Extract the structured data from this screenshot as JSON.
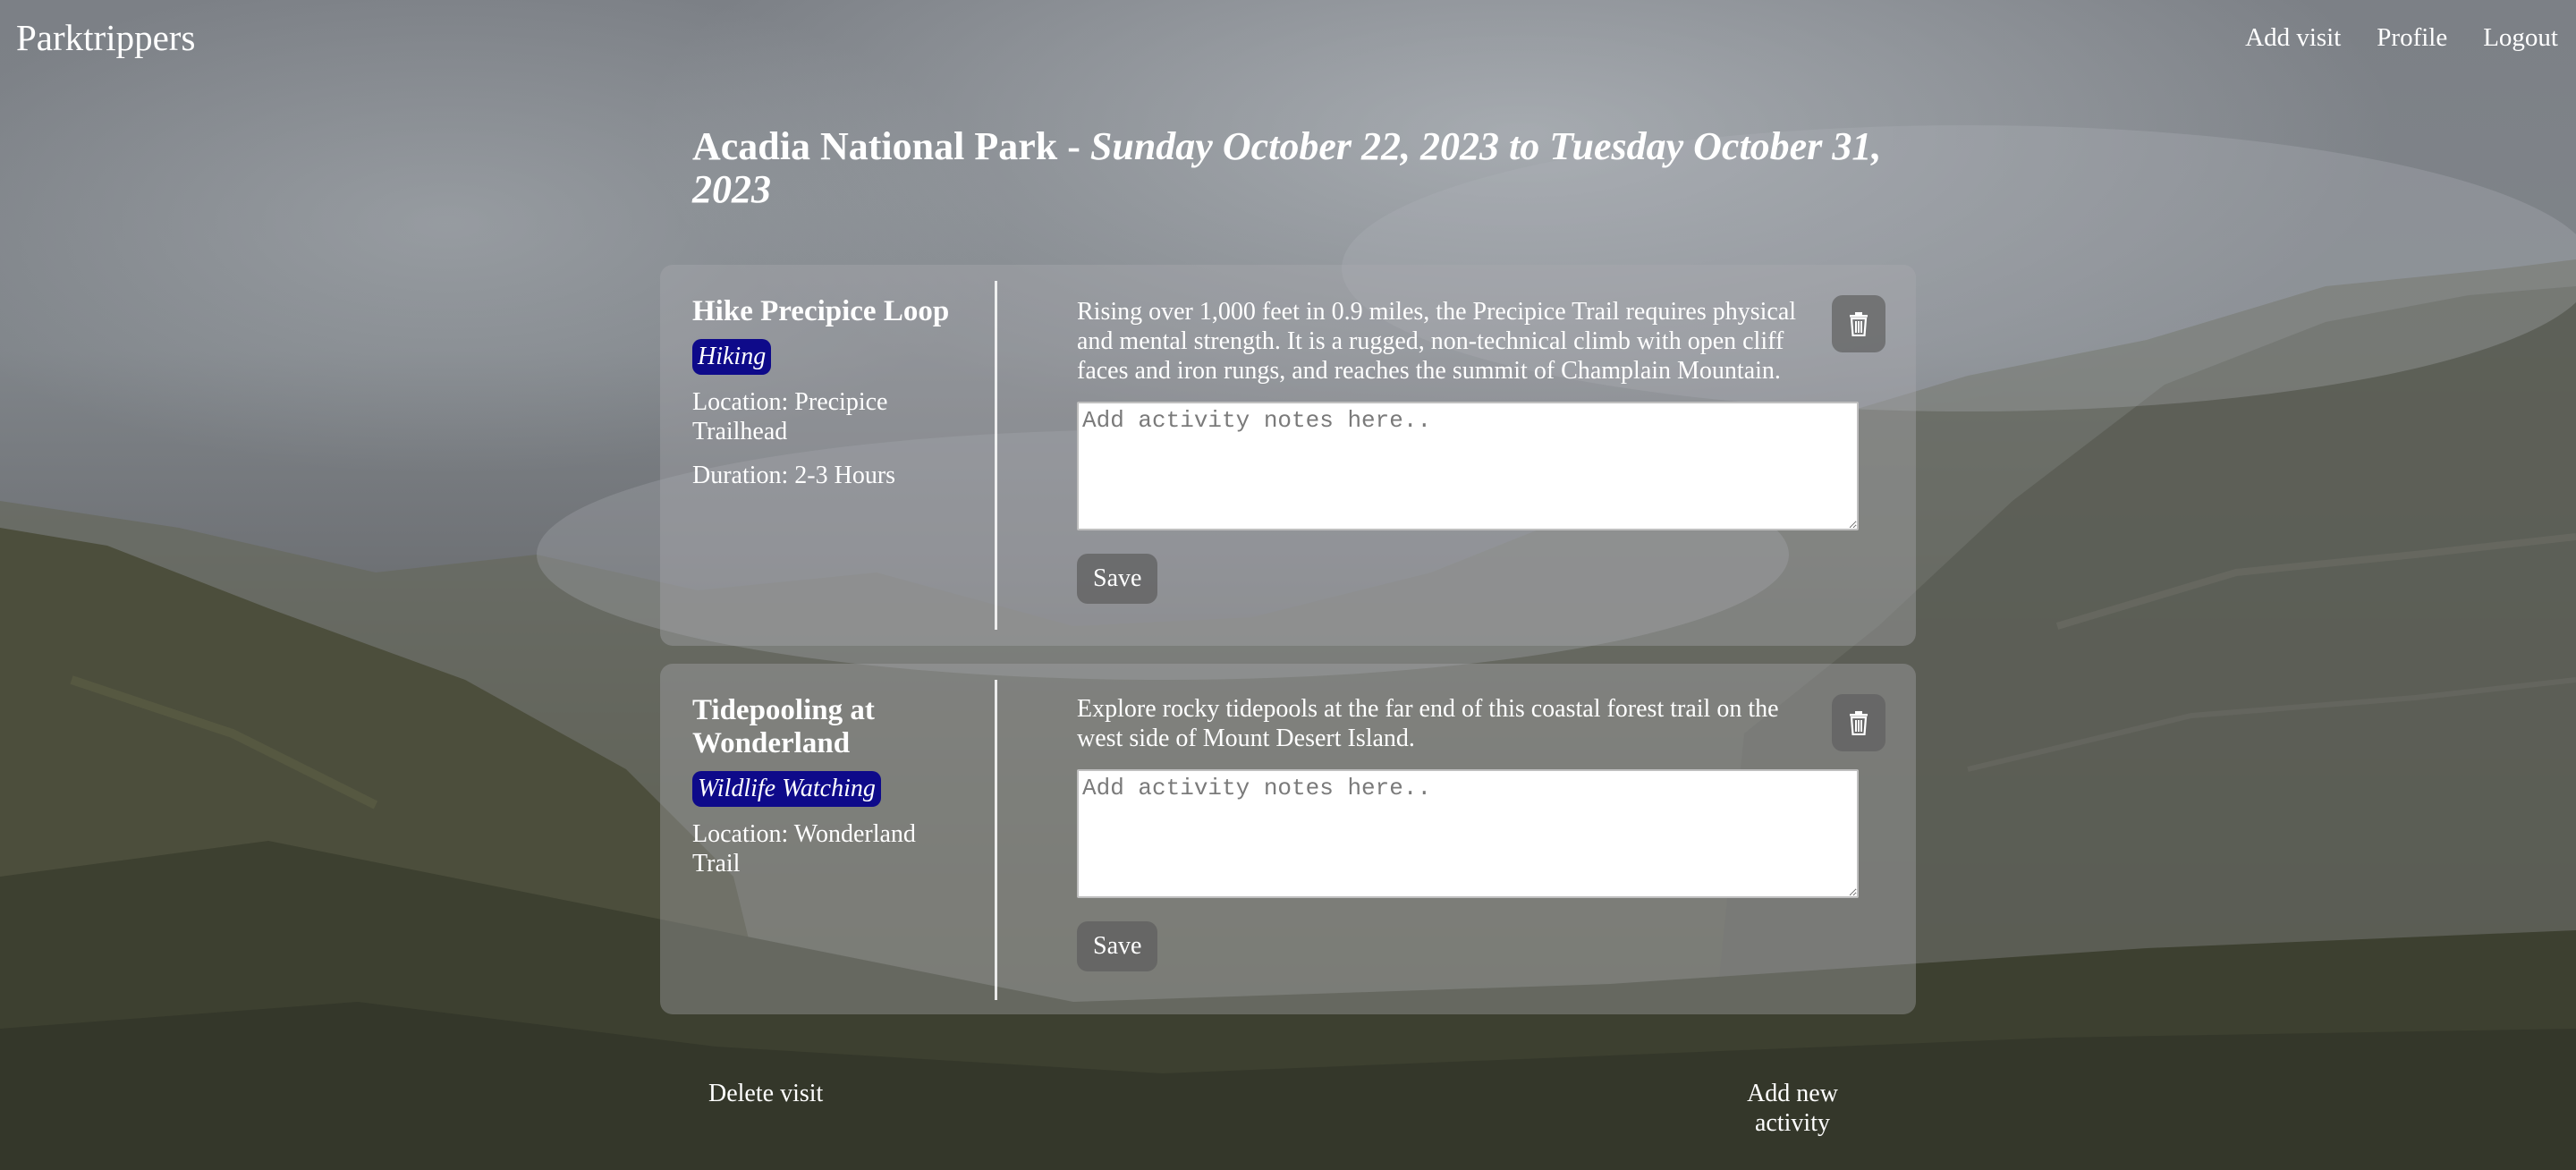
{
  "nav": {
    "brand": "Parktrippers",
    "links": [
      "Add visit",
      "Profile",
      "Logout"
    ]
  },
  "visit": {
    "park": "Acadia National Park",
    "separator": " - ",
    "dates": "Sunday October 22, 2023 to Tuesday October 31, 2023"
  },
  "activities": [
    {
      "title": "Hike Precipice Loop",
      "category": "Hiking",
      "location": "Location: Precipice Trailhead",
      "duration": "Duration: 2-3 Hours",
      "description": "Rising over 1,000 feet in 0.9 miles, the Precipice Trail requires physical and mental strength. It is a rugged, non-technical climb with open cliff faces and iron rungs, and reaches the summit of Champlain Mountain.",
      "notes_value": "",
      "notes_placeholder": "Add activity notes here..",
      "save_label": "Save",
      "delete_icon": "trash-icon"
    },
    {
      "title": "Tidepooling at Wonderland",
      "category": "Wildlife Watching",
      "location": "Location: Wonderland Trail",
      "description": "Explore rocky tidepools at the far end of this coastal forest trail on the west side of Mount Desert Island.",
      "notes_value": "",
      "notes_placeholder": "Add activity notes here..",
      "save_label": "Save",
      "delete_icon": "trash-icon"
    }
  ],
  "footer": {
    "delete_visit": "Delete visit",
    "add_activity": "Add new activity"
  },
  "colors": {
    "badge": "#0e0a8a",
    "card": "rgba(170,172,176,0.38)",
    "button": "rgba(95,95,95,0.75)"
  }
}
